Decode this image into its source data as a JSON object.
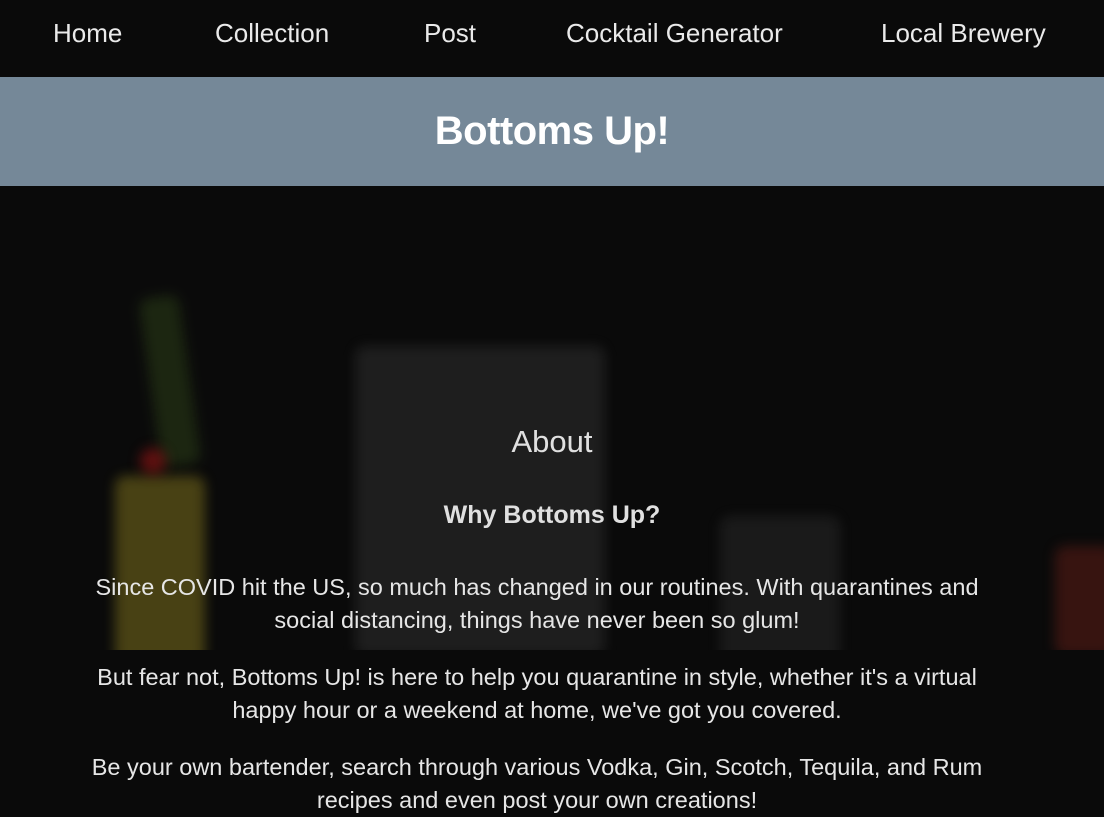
{
  "nav": {
    "items": [
      {
        "label": "Home"
      },
      {
        "label": "Collection"
      },
      {
        "label": "Post"
      },
      {
        "label": "Cocktail Generator"
      },
      {
        "label": "Local Brewery"
      }
    ]
  },
  "banner": {
    "title": "Bottoms Up!"
  },
  "about": {
    "heading": "About",
    "subheading": "Why Bottoms Up?",
    "paragraphs": [
      "Since COVID hit the US, so much has changed in our routines. With quarantines and social distancing, things have never been so glum!",
      "But fear not, Bottoms Up! is here to help you quarantine in style, whether it's a virtual happy hour or a weekend at home, we've got you covered.",
      "Be your own bartender, search through various Vodka, Gin, Scotch, Tequila, and Rum recipes and even post your own creations!"
    ]
  },
  "colors": {
    "nav_bg": "#0a0a0a",
    "banner_bg": "#758898",
    "page_bg": "#0a0a0a"
  }
}
